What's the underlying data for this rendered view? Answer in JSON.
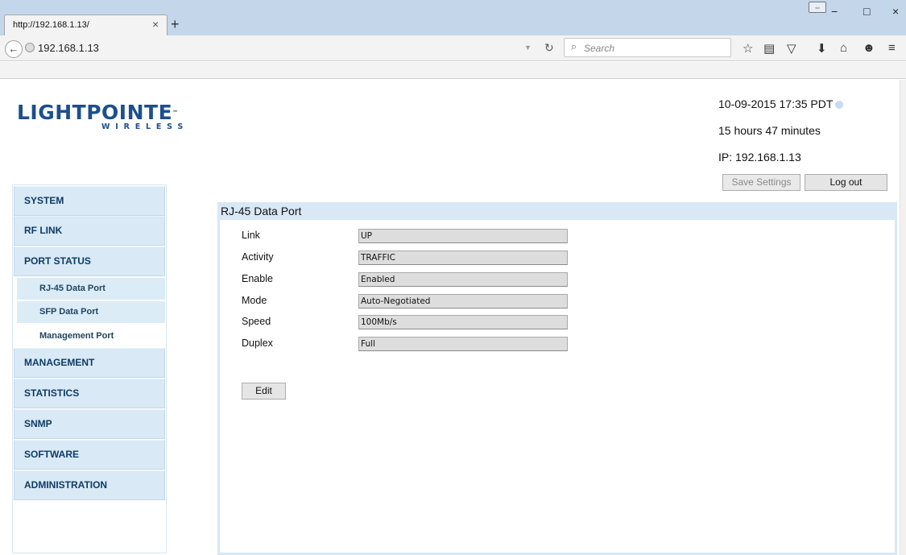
{
  "browser": {
    "tab_title": "http://192.168.1.13/",
    "tab_close": "×",
    "new_tab": "+",
    "url": "192.168.1.13",
    "search_placeholder": "Search",
    "window_controls": {
      "minimize": "−",
      "maximize": "□",
      "close": "×"
    }
  },
  "header": {
    "logo_text": "LIGHTPOINTE",
    "logo_tm": "™",
    "logo_subtext": "WIRELESS",
    "datetime": "10-09-2015 17:35 PDT",
    "uptime": "15 hours 47 minutes",
    "ip": "IP: 192.168.1.13",
    "save_settings": "Save Settings",
    "logout": "Log out"
  },
  "sidebar": {
    "items": [
      {
        "label": "SYSTEM"
      },
      {
        "label": "RF LINK"
      },
      {
        "label": "PORT STATUS"
      },
      {
        "label": "MANAGEMENT"
      },
      {
        "label": "STATISTICS"
      },
      {
        "label": "SNMP"
      },
      {
        "label": "SOFTWARE"
      },
      {
        "label": "ADMINISTRATION"
      }
    ],
    "subitems": [
      {
        "label": "RJ-45 Data Port",
        "selected": true
      },
      {
        "label": "SFP Data Port",
        "selected": false
      },
      {
        "label": "Management Port",
        "selected": false
      }
    ]
  },
  "main": {
    "title": "RJ-45 Data Port",
    "fields": [
      {
        "label": "Link",
        "value": "UP"
      },
      {
        "label": "Activity",
        "value": "TRAFFIC"
      },
      {
        "label": "Enable",
        "value": "Enabled"
      },
      {
        "label": "Mode",
        "value": "Auto-Negotiated"
      },
      {
        "label": "Speed",
        "value": "100Mb/s"
      },
      {
        "label": "Duplex",
        "value": "Full"
      }
    ],
    "edit_button": "Edit"
  },
  "colors": {
    "brand": "#1b4f8f",
    "nav_bg": "#d9e9f5",
    "panel_header": "#d8e8f4",
    "field_bg": "#dddddd"
  }
}
